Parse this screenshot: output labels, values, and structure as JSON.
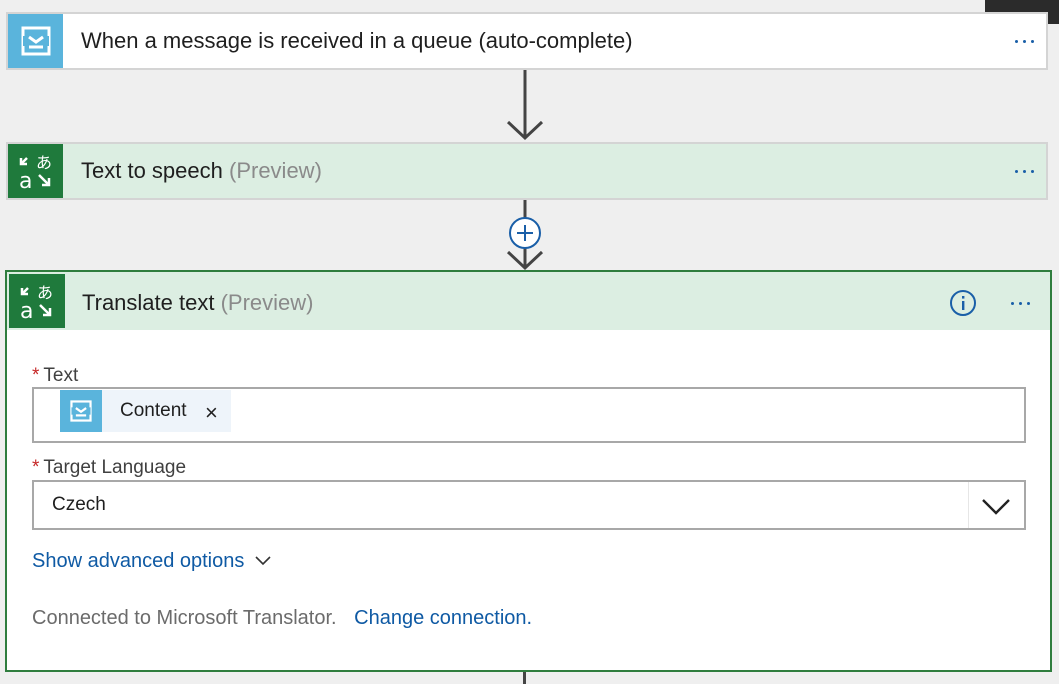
{
  "trigger_card": {
    "title": "When a message is received in a queue (auto-complete)",
    "icon": "service-bus-queue-icon",
    "menu_icon": "more-options-icon"
  },
  "tts_card": {
    "title": "Text to speech",
    "preview_tag": "(Preview)",
    "icon": "translator-icon"
  },
  "add_step": {
    "icon": "add-step-plus-icon"
  },
  "translate_card": {
    "title": "Translate text",
    "preview_tag": "(Preview)",
    "icon": "translator-icon",
    "info_icon": "info-icon",
    "text_field": {
      "required_mark": "*",
      "label": "Text",
      "token": {
        "label": "Content",
        "remove": "×",
        "icon": "service-bus-queue-icon"
      }
    },
    "language_field": {
      "required_mark": "*",
      "label": "Target Language",
      "value": "Czech"
    },
    "advanced_link": "Show advanced options",
    "connection_text": "Connected to Microsoft Translator.",
    "change_connection": "Change connection."
  },
  "colors": {
    "queue_icon_bg": "#5ab4dc",
    "translator_icon_bg": "#1f7a3c",
    "action_header_bg": "#dceee2",
    "selected_border": "#2f7d3e",
    "link": "#0f5aa4",
    "required": "#c62828"
  }
}
